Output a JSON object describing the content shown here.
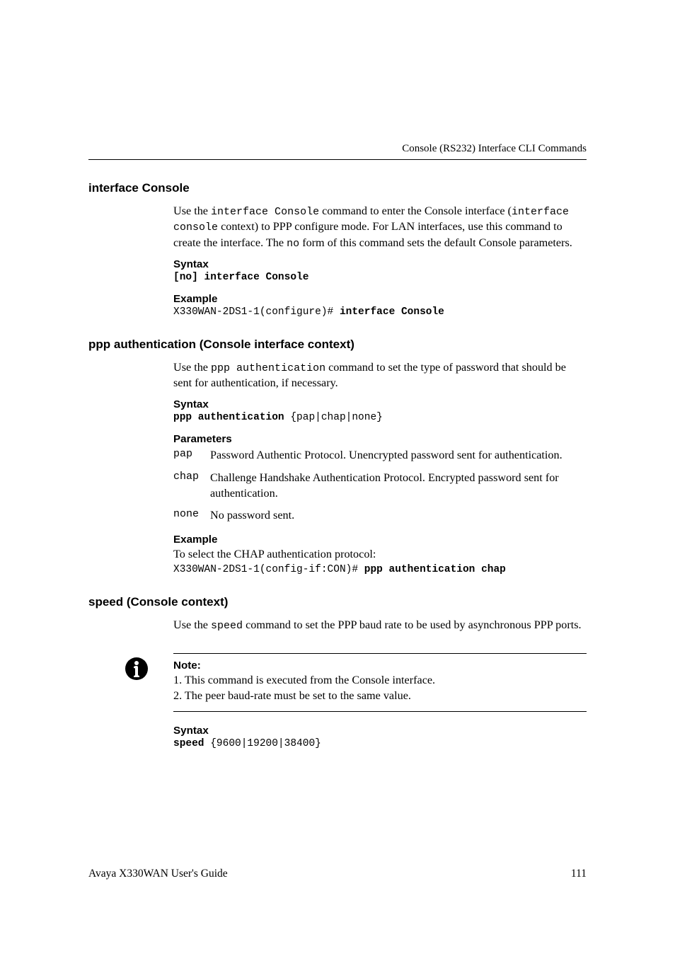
{
  "header": {
    "text": "Console (RS232) Interface CLI Commands"
  },
  "sections": {
    "interfaceConsole": {
      "heading": "interface Console",
      "para_pre": "Use the ",
      "code1": "interface Console",
      "para_mid1": " command to enter the Console interface (",
      "code2": "interface console",
      "para_mid2": " context) to PPP configure mode. For LAN interfaces, use this command to create the interface. The ",
      "code3": "no",
      "para_post": " form of this command sets the default Console parameters.",
      "syntax_label": "Syntax",
      "syntax_code": "[no] interface Console",
      "example_label": "Example",
      "example_prefix": "X330WAN-2DS1-1(configure)# ",
      "example_bold": "interface Console"
    },
    "pppAuth": {
      "heading": "ppp authentication (Console interface context)",
      "para_pre": "Use the ",
      "code1": "ppp authentication",
      "para_post": " command to set the type of password that should be sent for authentication, if necessary.",
      "syntax_label": "Syntax",
      "syntax_bold": "ppp authentication",
      "syntax_rest": " {pap|chap|none}",
      "params_label": "Parameters",
      "params": [
        {
          "key": "pap",
          "desc": "Password Authentic Protocol. Unencrypted password sent for authentication."
        },
        {
          "key": "chap",
          "desc": "Challenge Handshake Authentication Protocol. Encrypted password sent for authentication."
        },
        {
          "key": "none",
          "desc": "No password sent."
        }
      ],
      "example_label": "Example",
      "example_intro": "To select the CHAP authentication protocol:",
      "example_prefix": "X330WAN-2DS1-1(config-if:CON)# ",
      "example_bold": "ppp authentication chap"
    },
    "speed": {
      "heading": "speed (Console context)",
      "para_pre": "Use the ",
      "code1": "speed",
      "para_post": " command to set the PPP baud rate to be used by asynchronous PPP ports.",
      "note_label": "Note:",
      "note_items": [
        "1.  This command is executed from the Console interface.",
        "2.  The peer baud-rate must be set to the same value."
      ],
      "syntax_label": "Syntax",
      "syntax_bold": "speed",
      "syntax_rest": " {9600|19200|38400}"
    }
  },
  "footer": {
    "left": "Avaya X330WAN User's Guide",
    "right": "111"
  }
}
